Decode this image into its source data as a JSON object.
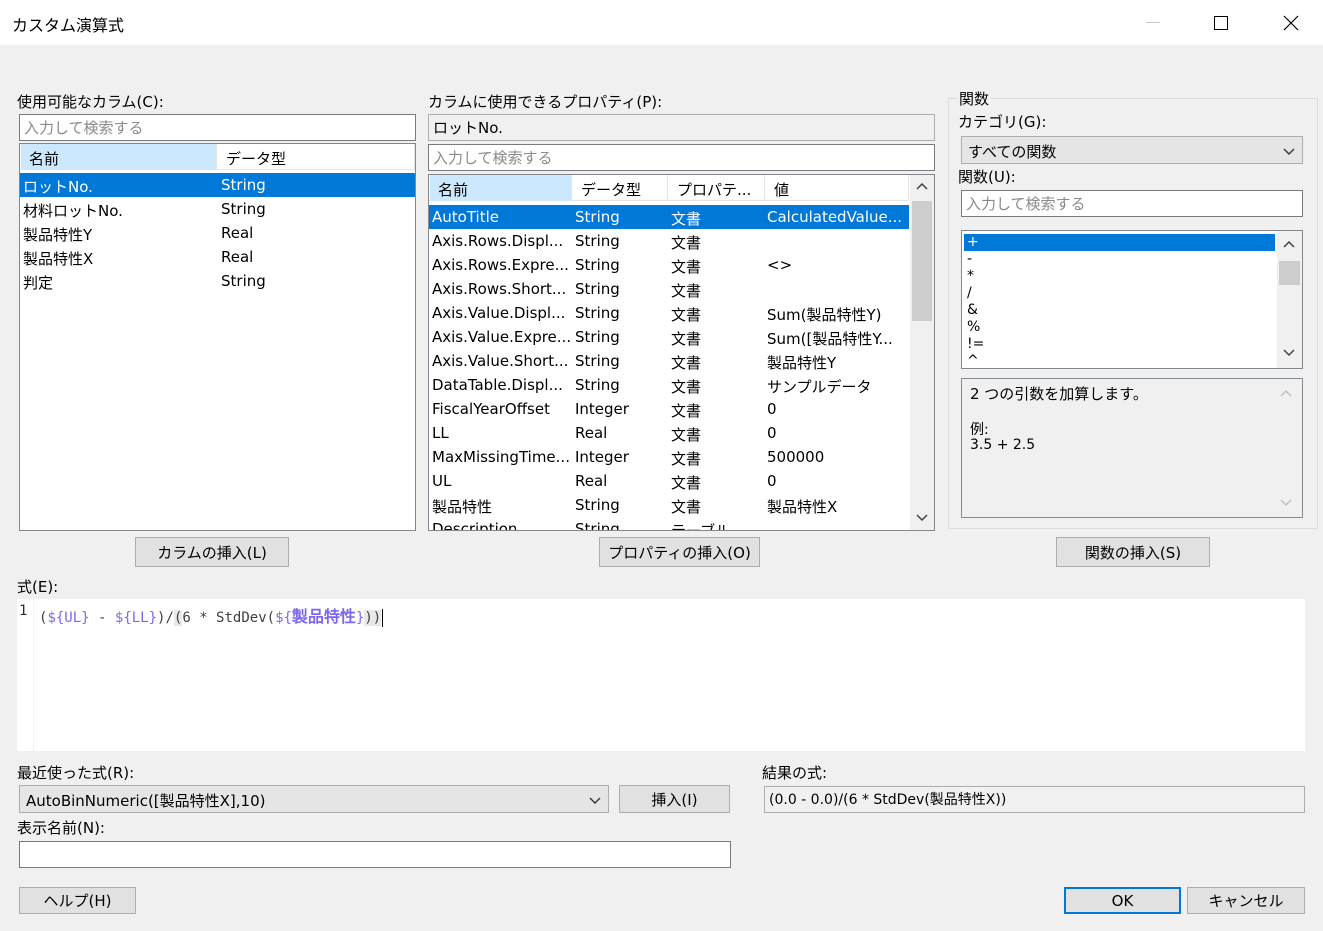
{
  "window": {
    "title": "カスタム演算式"
  },
  "columns_panel": {
    "label": "使用可能なカラム(C):",
    "search_placeholder": "入力して検索する",
    "headers": [
      "名前",
      "データ型"
    ],
    "rows": [
      {
        "name": "ロットNo.",
        "type": "String"
      },
      {
        "name": "材料ロットNo.",
        "type": "String"
      },
      {
        "name": "製品特性Y",
        "type": "Real"
      },
      {
        "name": "製品特性X",
        "type": "Real"
      },
      {
        "name": "判定",
        "type": "String"
      }
    ],
    "insert_button": "カラムの挿入(L)"
  },
  "properties_panel": {
    "label": "カラムに使用できるプロパティ(P):",
    "selected_column": "ロットNo.",
    "search_placeholder": "入力して検索する",
    "headers": [
      "名前",
      "データ型",
      "プロパテ...",
      "値"
    ],
    "rows": [
      {
        "name": "AutoTitle",
        "type": "String",
        "prop": "文書",
        "value": "CalculatedValue..."
      },
      {
        "name": "Axis.Rows.Displ...",
        "type": "String",
        "prop": "文書",
        "value": ""
      },
      {
        "name": "Axis.Rows.Expre...",
        "type": "String",
        "prop": "文書",
        "value": "<>"
      },
      {
        "name": "Axis.Rows.Short...",
        "type": "String",
        "prop": "文書",
        "value": ""
      },
      {
        "name": "Axis.Value.Displ...",
        "type": "String",
        "prop": "文書",
        "value": "Sum(製品特性Y)"
      },
      {
        "name": "Axis.Value.Expre...",
        "type": "String",
        "prop": "文書",
        "value": "Sum([製品特性Y..."
      },
      {
        "name": "Axis.Value.Short...",
        "type": "String",
        "prop": "文書",
        "value": "製品特性Y"
      },
      {
        "name": "DataTable.Displ...",
        "type": "String",
        "prop": "文書",
        "value": "サンプルデータ"
      },
      {
        "name": "FiscalYearOffset",
        "type": "Integer",
        "prop": "文書",
        "value": "0"
      },
      {
        "name": "LL",
        "type": "Real",
        "prop": "文書",
        "value": "0"
      },
      {
        "name": "MaxMissingTime...",
        "type": "Integer",
        "prop": "文書",
        "value": "500000"
      },
      {
        "name": "UL",
        "type": "Real",
        "prop": "文書",
        "value": "0"
      },
      {
        "name": "製品特性",
        "type": "String",
        "prop": "文書",
        "value": "製品特性X"
      },
      {
        "name": "Description",
        "type": "String",
        "prop": "テーブル",
        "value": ""
      }
    ],
    "insert_button": "プロパティの挿入(O)"
  },
  "functions_panel": {
    "group_label": "関数",
    "category_label": "カテゴリ(G):",
    "category_value": "すべての関数",
    "function_label": "関数(U):",
    "search_placeholder": "入力して検索する",
    "items": [
      "+",
      "-",
      "*",
      "/",
      "&",
      "%",
      "!=",
      "^"
    ],
    "description": "2 つの引数を加算します。",
    "example_label": "例:",
    "example": "3.5 + 2.5",
    "insert_button": "関数の挿入(S)"
  },
  "expression": {
    "label": "式(E):",
    "line_number": "1",
    "tokens": [
      {
        "text": "(",
        "color": "#404040"
      },
      {
        "text": "${UL}",
        "color": "#7b68ee"
      },
      {
        "text": " - ",
        "color": "#404040"
      },
      {
        "text": "${LL}",
        "color": "#7b68ee"
      },
      {
        "text": ")/",
        "color": "#404040"
      },
      {
        "text": "(",
        "color": "#404040"
      },
      {
        "text": "6 * StdDev(",
        "color": "#404040"
      },
      {
        "text": "${",
        "color": "#7b68ee"
      },
      {
        "text": "製品特性",
        "color": "#7b68ee"
      },
      {
        "text": "}",
        "color": "#7b68ee"
      },
      {
        "text": "))",
        "color": "#404040"
      }
    ]
  },
  "recent": {
    "label": "最近使った式(R):",
    "value": "AutoBinNumeric([製品特性X],10)",
    "insert_button": "挿入(I)"
  },
  "result": {
    "label": "結果の式:",
    "value": "(0.0 - 0.0)/(6 * StdDev(製品特性X))"
  },
  "display_name": {
    "label": "表示名前(N):",
    "value": ""
  },
  "buttons": {
    "help": "ヘルプ(H)",
    "ok": "OK",
    "cancel": "キャンセル"
  }
}
